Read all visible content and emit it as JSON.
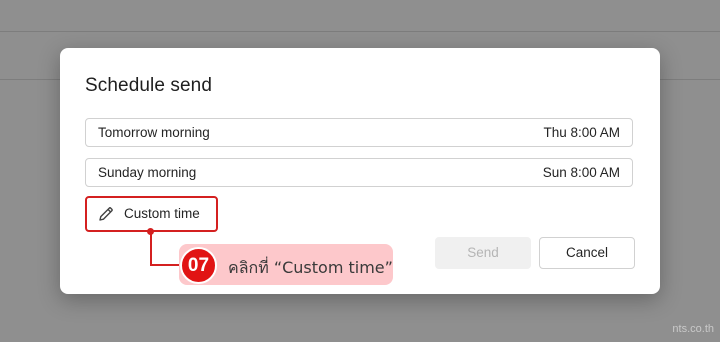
{
  "dialog": {
    "title": "Schedule send",
    "options": [
      {
        "label": "Tomorrow morning",
        "time": "Thu 8:00 AM"
      },
      {
        "label": "Sunday morning",
        "time": "Sun 8:00 AM"
      }
    ],
    "custom_time_label": "Custom time",
    "send_label": "Send",
    "cancel_label": "Cancel",
    "send_enabled": false
  },
  "callout": {
    "step_number": "07",
    "text": "คลิกที่ “Custom time”",
    "color": "#d42020",
    "fill": "#fdc8cb"
  },
  "watermark": "nts.co.th"
}
